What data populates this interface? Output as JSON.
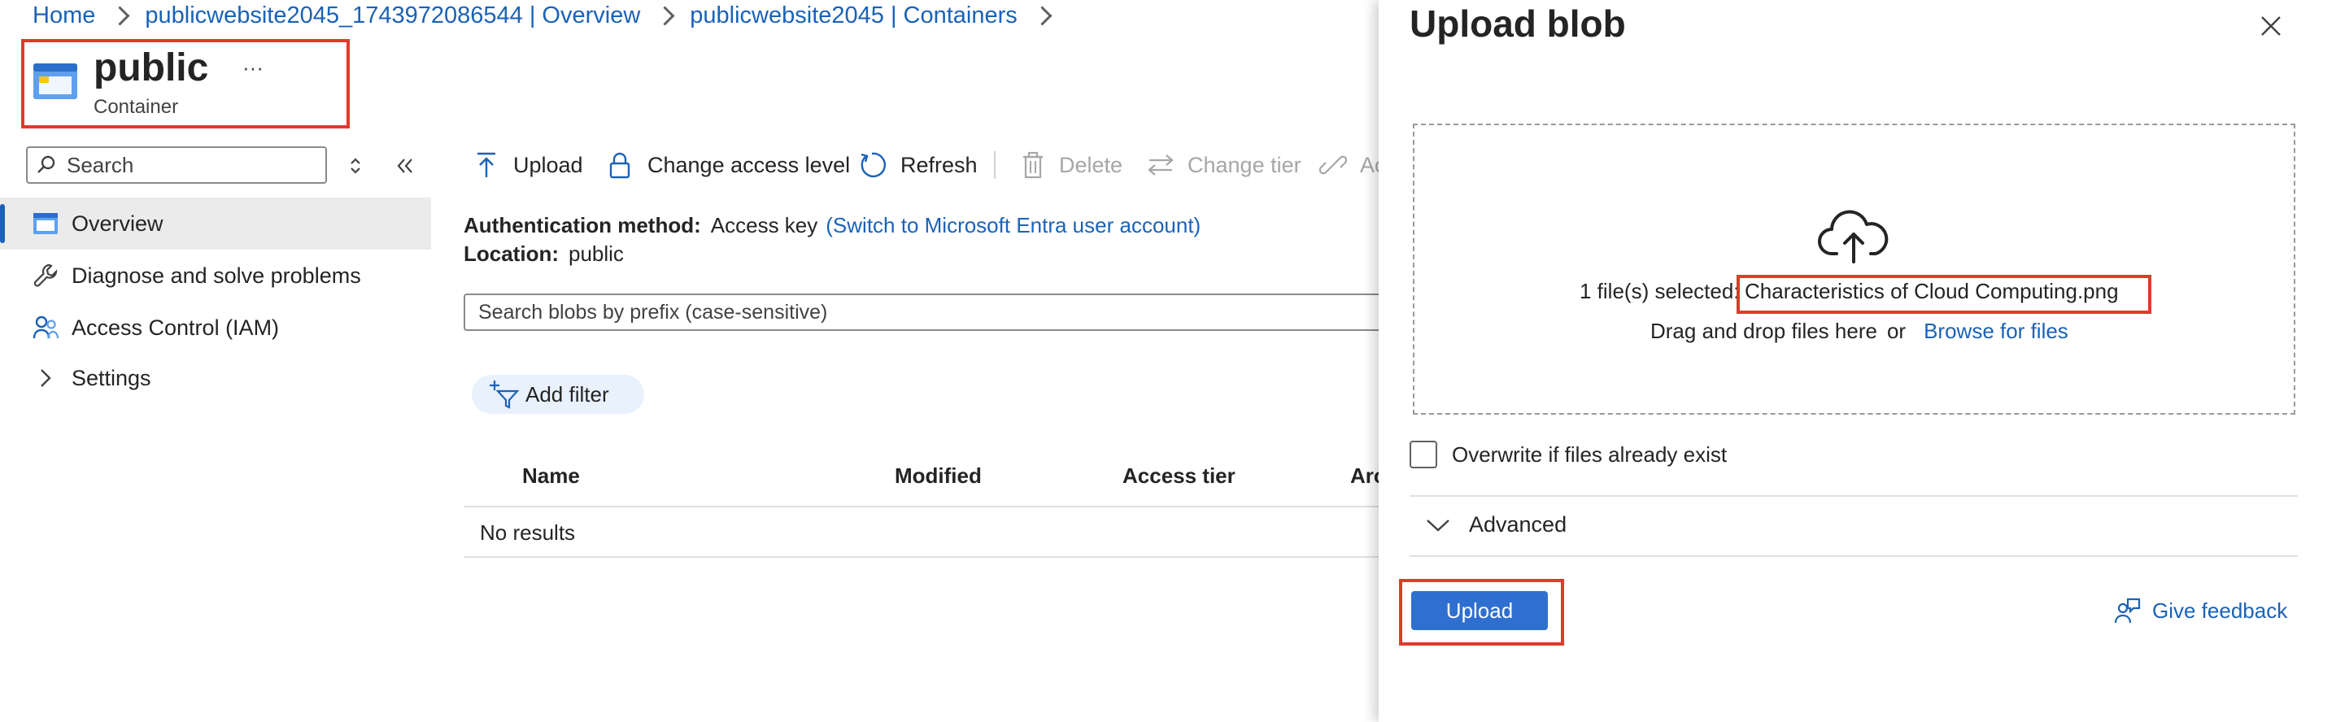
{
  "breadcrumb": {
    "items": [
      "Home",
      "publicwebsite2045_1743972086544 | Overview",
      "publicwebsite2045 | Containers"
    ]
  },
  "resource": {
    "title": "public",
    "subtitle": "Container",
    "more": "···"
  },
  "sidebar": {
    "search_placeholder": "Search",
    "items": [
      {
        "label": "Overview",
        "icon": "container-icon"
      },
      {
        "label": "Diagnose and solve problems",
        "icon": "wrench-icon"
      },
      {
        "label": "Access Control (IAM)",
        "icon": "people-icon"
      },
      {
        "label": "Settings",
        "icon": "chevron-right-icon"
      }
    ]
  },
  "toolbar": {
    "upload": "Upload",
    "change_access": "Change access level",
    "refresh": "Refresh",
    "delete": "Delete",
    "change_tier": "Change tier",
    "acquire": "Ac"
  },
  "main": {
    "auth_label": "Authentication method:",
    "auth_value": "Access key",
    "auth_link": "(Switch to Microsoft Entra user account)",
    "location_label": "Location:",
    "location_value": "public",
    "search_placeholder": "Search blobs by prefix (case-sensitive)",
    "add_filter": "Add filter",
    "table": {
      "columns": [
        "Name",
        "Modified",
        "Access tier",
        "Arc"
      ],
      "empty": "No results"
    }
  },
  "panel": {
    "title": "Upload blob",
    "selected_label": "1 file(s) selected:",
    "selected_file": "Characteristics of Cloud Computing.png",
    "drag_text": "Drag and drop files here",
    "or": "or",
    "browse": "Browse for files",
    "overwrite": "Overwrite if files already exist",
    "overwrite_checked": false,
    "advanced": "Advanced",
    "upload_button": "Upload",
    "feedback": "Give feedback"
  },
  "colors": {
    "accent": "#1a62b8",
    "primary_button": "#2f6fcf",
    "highlight": "#e03a2b"
  }
}
